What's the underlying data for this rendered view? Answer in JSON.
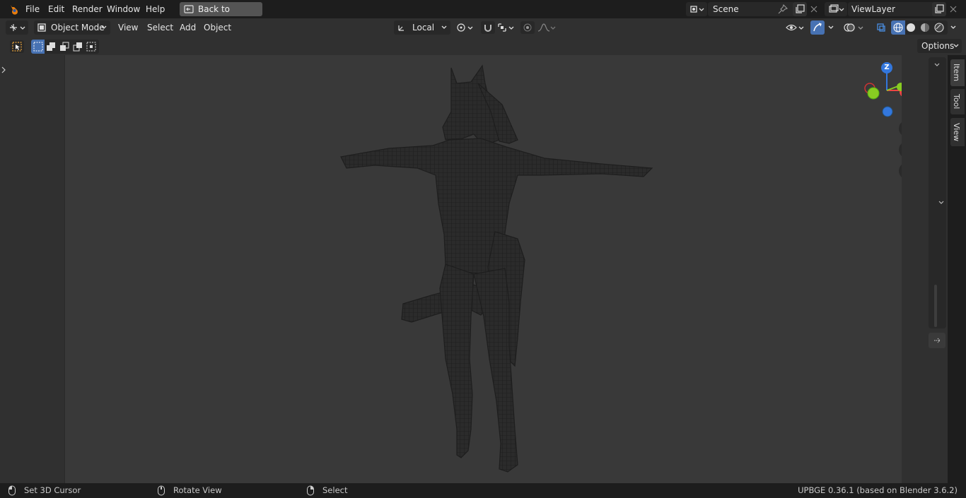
{
  "menubar": {
    "items": [
      "File",
      "Edit",
      "Render",
      "Window",
      "Help"
    ],
    "back_label": "Back to Previous",
    "scene_name": "Scene",
    "viewlayer_name": "ViewLayer"
  },
  "header": {
    "mode": "Object Mode",
    "menus": [
      "View",
      "Select",
      "Add",
      "Object"
    ],
    "transform_orientation": "Local"
  },
  "tool_header": {
    "options_label": "Options"
  },
  "sidebar": {
    "tabs": [
      "Item",
      "Tool",
      "View"
    ]
  },
  "gizmo": {
    "z_label": "Z",
    "x_label": "X",
    "colors": {
      "x": "#e44",
      "y": "#8c2",
      "z": "#37d"
    }
  },
  "statusbar": {
    "items": [
      "Set 3D Cursor",
      "Rotate View",
      "Select"
    ],
    "version": "UPBGE 0.36.1 (based on Blender 3.6.2)"
  },
  "colors": {
    "accent": "#4772b3",
    "viewport_bg": "#393939",
    "panel_bg": "#303030"
  }
}
